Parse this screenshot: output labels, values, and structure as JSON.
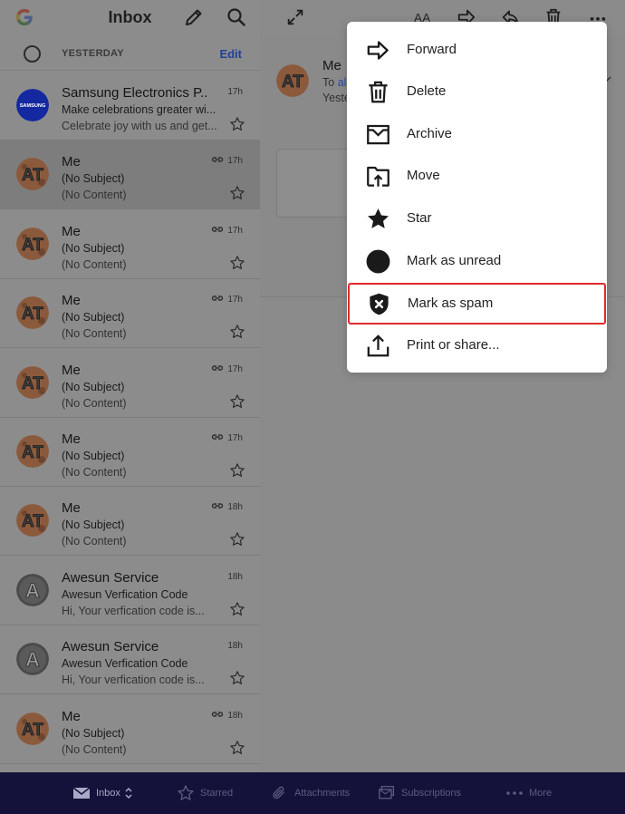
{
  "left_pane": {
    "title": "Inbox",
    "section_label": "YESTERDAY",
    "edit_label": "Edit",
    "messages": [
      {
        "sender": "Samsung Electronics P...",
        "subject": "Make celebrations greater wi...",
        "preview": "Celebrate joy with us and get...",
        "time": "17h",
        "attachment": false,
        "avatar": "samsung"
      },
      {
        "sender": "Me",
        "subject": "(No Subject)",
        "preview": "(No Content)",
        "time": "17h",
        "attachment": true,
        "avatar": "at"
      },
      {
        "sender": "Me",
        "subject": "(No Subject)",
        "preview": "(No Content)",
        "time": "17h",
        "attachment": true,
        "avatar": "at"
      },
      {
        "sender": "Me",
        "subject": "(No Subject)",
        "preview": "(No Content)",
        "time": "17h",
        "attachment": true,
        "avatar": "at"
      },
      {
        "sender": "Me",
        "subject": "(No Subject)",
        "preview": "(No Content)",
        "time": "17h",
        "attachment": true,
        "avatar": "at"
      },
      {
        "sender": "Me",
        "subject": "(No Subject)",
        "preview": "(No Content)",
        "time": "17h",
        "attachment": true,
        "avatar": "at"
      },
      {
        "sender": "Me",
        "subject": "(No Subject)",
        "preview": "(No Content)",
        "time": "18h",
        "attachment": true,
        "avatar": "at"
      },
      {
        "sender": "Awesun Service",
        "subject": "Awesun Verfication Code",
        "preview": "Hi,   Your verfication code is...",
        "time": "18h",
        "attachment": false,
        "avatar": "a"
      },
      {
        "sender": "Awesun Service",
        "subject": "Awesun Verfication Code",
        "preview": "Hi,   Your verfication code is...",
        "time": "18h",
        "attachment": false,
        "avatar": "a"
      },
      {
        "sender": "Me",
        "subject": "(No Subject)",
        "preview": "(No Content)",
        "time": "18h",
        "attachment": true,
        "avatar": "at"
      }
    ]
  },
  "reading_pane": {
    "sender": "Me",
    "to_prefix": "To",
    "to_name": "al",
    "date_partial": "Yeste"
  },
  "avatars": {
    "samsung_text": "SAMSUNG",
    "at_text": "AT",
    "a_text": "A"
  },
  "context_menu": {
    "items": [
      {
        "label": "Forward",
        "icon": "forward-arrow-icon"
      },
      {
        "label": "Delete",
        "icon": "trash-icon"
      },
      {
        "label": "Archive",
        "icon": "archive-tray-icon"
      },
      {
        "label": "Move",
        "icon": "move-folder-icon"
      },
      {
        "label": "Star",
        "icon": "star-icon"
      },
      {
        "label": "Mark as unread",
        "icon": "unread-dot-icon"
      },
      {
        "label": "Mark as spam",
        "icon": "spam-shield-icon"
      },
      {
        "label": "Print or share...",
        "icon": "share-icon"
      }
    ],
    "highlighted_label": "Mark as spam"
  },
  "tab_bar": {
    "tabs": [
      {
        "label": "Inbox",
        "icon": "envelope-icon"
      },
      {
        "label": "Starred",
        "icon": "star-outline-icon"
      },
      {
        "label": "Attachments",
        "icon": "paperclip-icon"
      },
      {
        "label": "Subscriptions",
        "icon": "subscriptions-icon"
      },
      {
        "label": "More",
        "icon": "more-dots-icon"
      }
    ]
  },
  "colors": {
    "overlay_bg": "#8a8a8a",
    "menu_bg": "#ffffff",
    "highlight_border": "#e02b2b",
    "tabbar_bg": "#14123a",
    "samsung_blue": "#1428a0",
    "link_blue": "#21409a"
  }
}
